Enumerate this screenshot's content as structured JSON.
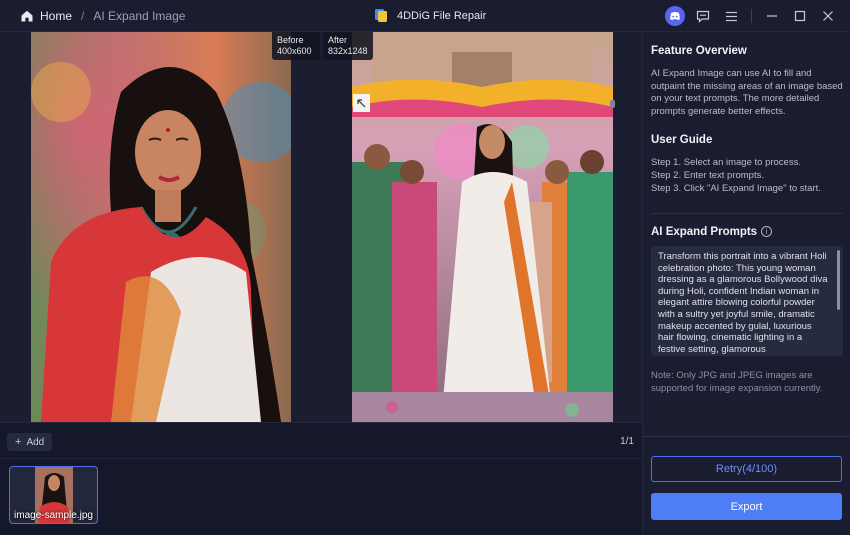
{
  "titlebar": {
    "home": "Home",
    "separator": "/",
    "current": "AI Expand Image",
    "app_title": "4DDiG File Repair"
  },
  "canvas": {
    "before_tag": "Before\n400x600",
    "after_tag": "After\n832x1248"
  },
  "bottom": {
    "add_label": "Add",
    "page_count": "1/1",
    "thumbnail_name": "image-sample.jpg"
  },
  "panel": {
    "overview_title": "Feature Overview",
    "overview_text": "AI Expand Image can use AI to fill and outpaint the missing areas of an image based on your text prompts. The more detailed prompts generate better effects.",
    "guide_title": "User Guide",
    "step1": "Step 1. Select an image to process.",
    "step2": "Step 2. Enter text prompts.",
    "step3": "Step 3. Click \"AI Expand Image\" to start.",
    "prompts_title": "AI Expand Prompts",
    "prompt_text": "Transform this portrait into a vibrant Holi celebration photo: This young woman dressing as a glamorous Bollywood diva during Holi, confident Indian woman in elegant attire blowing colorful powder with a sultry yet joyful smile, dramatic makeup accented by gulal, luxurious hair flowing, cinematic lighting in a festive setting, glamorous",
    "note": "Note: Only JPG and JPEG images are supported for image expansion currently.",
    "retry_label": "Retry(4/100)",
    "export_label": "Export"
  },
  "colors": {
    "accent": "#4f7df5",
    "background": "#15182a",
    "panel": "#1a1d2f"
  },
  "icons": [
    "home-icon",
    "app-logo-icon",
    "discord-icon",
    "feedback-icon",
    "menu-icon",
    "minimize-icon",
    "maximize-icon",
    "close-icon",
    "info-icon",
    "expand-corner-icon"
  ]
}
